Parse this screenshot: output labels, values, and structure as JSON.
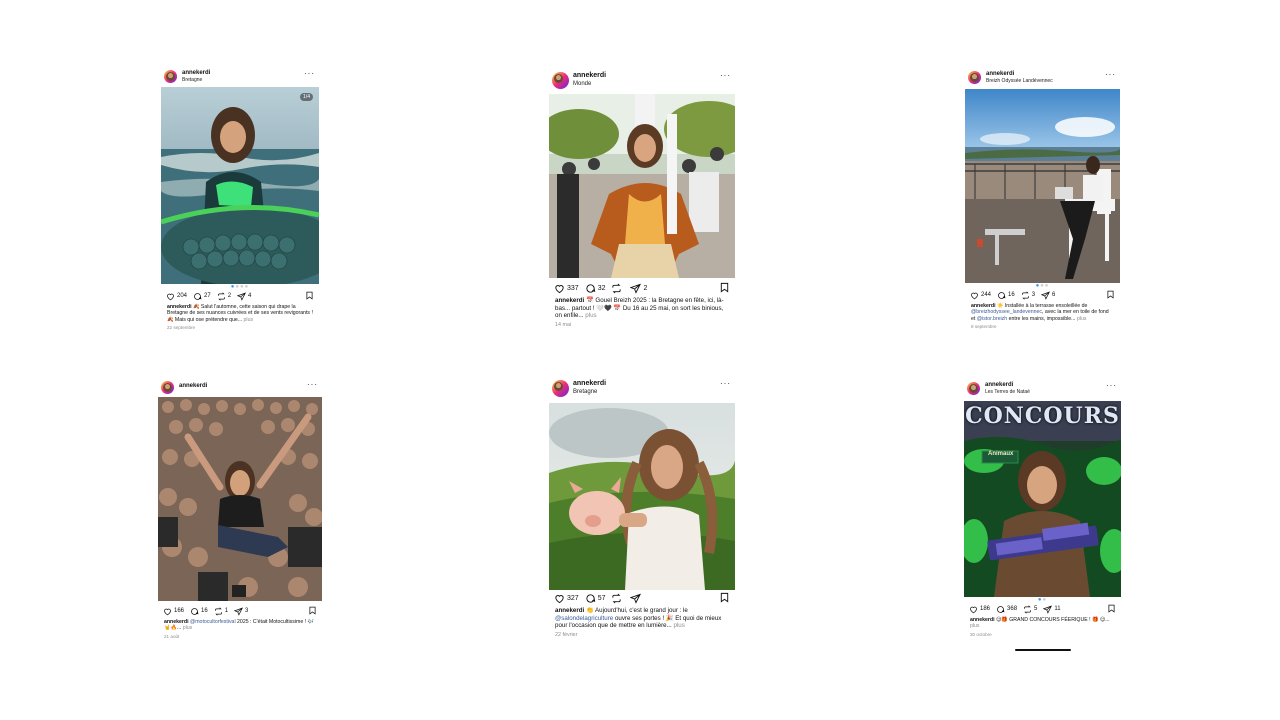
{
  "posts": [
    {
      "username": "annekerdi",
      "location": "Bretagne",
      "slide_counter": "1/4",
      "likes": "204",
      "comments": "27",
      "reposts": "2",
      "shares": "4",
      "caption": "🍂 Salut l'automne, cette saison qui drape la Bretagne de ses nuances cuivrées et de ses vents revigorants ! 🍂 Mais qui ose prétendre que...",
      "more": "plus",
      "date": "22 septembre"
    },
    {
      "username": "annekerdi",
      "location": "Monde",
      "likes": "337",
      "comments": "32",
      "reposts": "",
      "shares": "2",
      "caption": "📅 Gouel Breizh 2025 : la Bretagne en fête, ici, là-bas... partout ! 🤍🖤 📅 Du 16 au 25 mai, on sort les binious, on enfile...",
      "more": "plus",
      "date": "14 mai"
    },
    {
      "username": "annekerdi",
      "location": "Breizh Odyssée Landévennec",
      "likes": "244",
      "comments": "16",
      "reposts": "3",
      "shares": "6",
      "caption_pre": "☀️ Installée à la terrasse ensoleillée de ",
      "caption_link1": "@breizhodyssee_landevennec",
      "caption_mid": ", avec la mer en toile de fond et ",
      "caption_link2": "@istor.breizh",
      "caption_post": " entre les mains, impossible...",
      "more": "plus",
      "date": "8 septembre"
    },
    {
      "username": "annekerdi",
      "location": "",
      "likes": "166",
      "comments": "16",
      "reposts": "1",
      "shares": "3",
      "caption_link": "@motocultorfestival",
      "caption_post": " 2025 : C'était Motocultissime ! 🎶🤘🔥...",
      "more": "plus",
      "date": "21 août"
    },
    {
      "username": "annekerdi",
      "location": "Bretagne",
      "likes": "327",
      "comments": "57",
      "reposts": "",
      "shares": "",
      "caption_pre": "👏 Aujourd'hui, c'est le grand jour : le ",
      "caption_link": "@salondelagriculture",
      "caption_post": " ouvre ses portes ! 🎉 Et quoi de mieux pour l'occasion que de mettre en lumière...",
      "more": "plus",
      "date": "22 février"
    },
    {
      "username": "annekerdi",
      "location": "Les Terres de Nataé",
      "likes": "186",
      "comments": "368",
      "reposts": "5",
      "shares": "11",
      "caption": "😊🎁 GRAND CONCOURS FÉERIQUE ! 🎁 😊...",
      "more": "plus",
      "date": "30 octobre",
      "photo_title": "CONCOURS",
      "photo_sign": "Animaux"
    }
  ]
}
